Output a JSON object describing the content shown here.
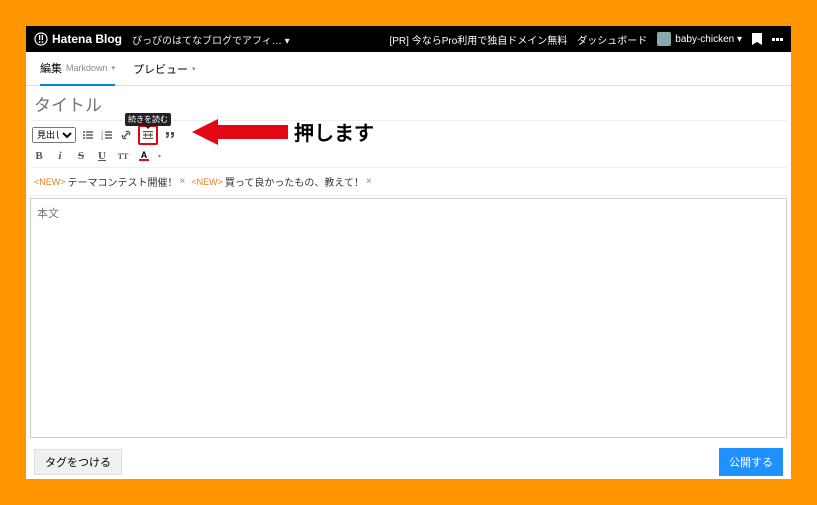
{
  "topbar": {
    "logo_text": "Hatena Blog",
    "blog_name": "ぴっぴのはてなブログでアフィ… ▾",
    "pr_text": "[PR] 今ならPro利用で独自ドメイン無料",
    "dashboard": "ダッシュボード",
    "username": "baby-chicken ▾"
  },
  "tabs": {
    "edit_label": "編集",
    "edit_mode": "Markdown",
    "preview_label": "プレビュー"
  },
  "editor": {
    "title_placeholder": "タイトル",
    "heading_option": "見出し",
    "body_placeholder": "本文",
    "tooltip": "続きを読む"
  },
  "annotation": {
    "text": "押します"
  },
  "topics": {
    "new_label": "<NEW>",
    "items": [
      "テーマコンテスト開催！",
      "買って良かったもの、教えて！"
    ]
  },
  "footer": {
    "tag_label": "タグをつける",
    "publish_label": "公開する"
  }
}
